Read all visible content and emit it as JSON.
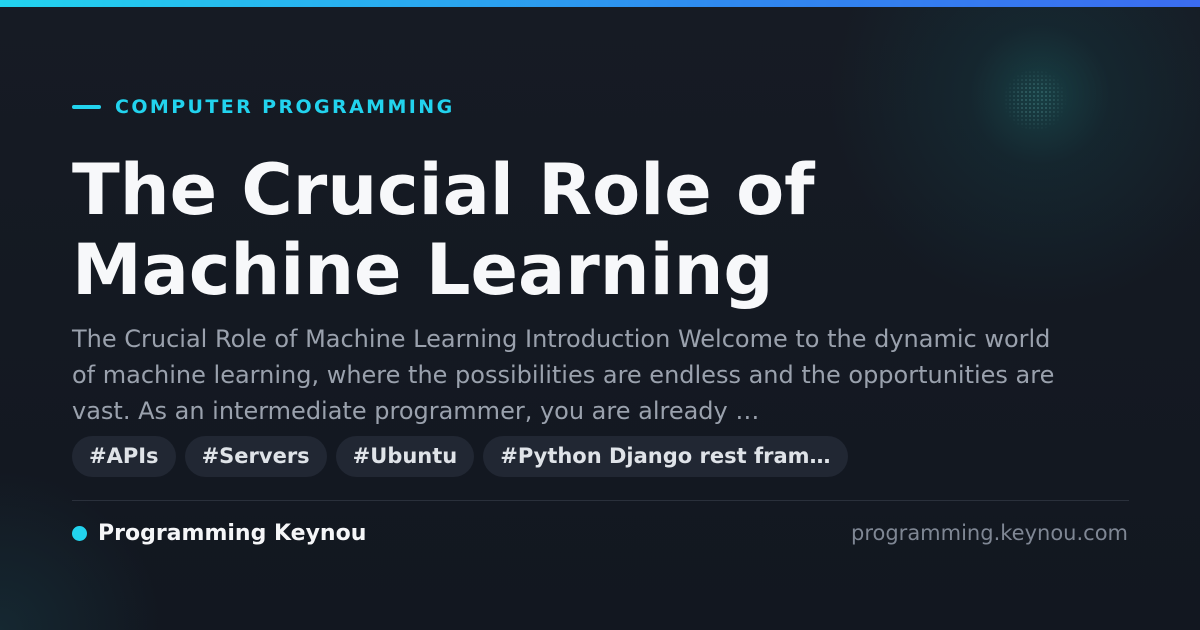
{
  "category": "COMPUTER PROGRAMMING",
  "title_lines": [
    "The Crucial Role of",
    "Machine Learning"
  ],
  "excerpt": "The Crucial Role of Machine Learning Introduction Welcome to the dynamic world of machine learning, where the possibilities are endless and the opportunities are vast. As an intermediate programmer, you are already …",
  "tags": [
    "#APIs",
    "#Servers",
    "#Ubuntu",
    "#Python Django rest fram…"
  ],
  "brand": "Programming Keynou",
  "domain": "programming.keynou.com",
  "colors": {
    "accent": "#22d3ee",
    "background": "#141922",
    "title": "#f7f8fa",
    "excerpt": "#9aa1ad",
    "tag_bg": "#212733"
  }
}
